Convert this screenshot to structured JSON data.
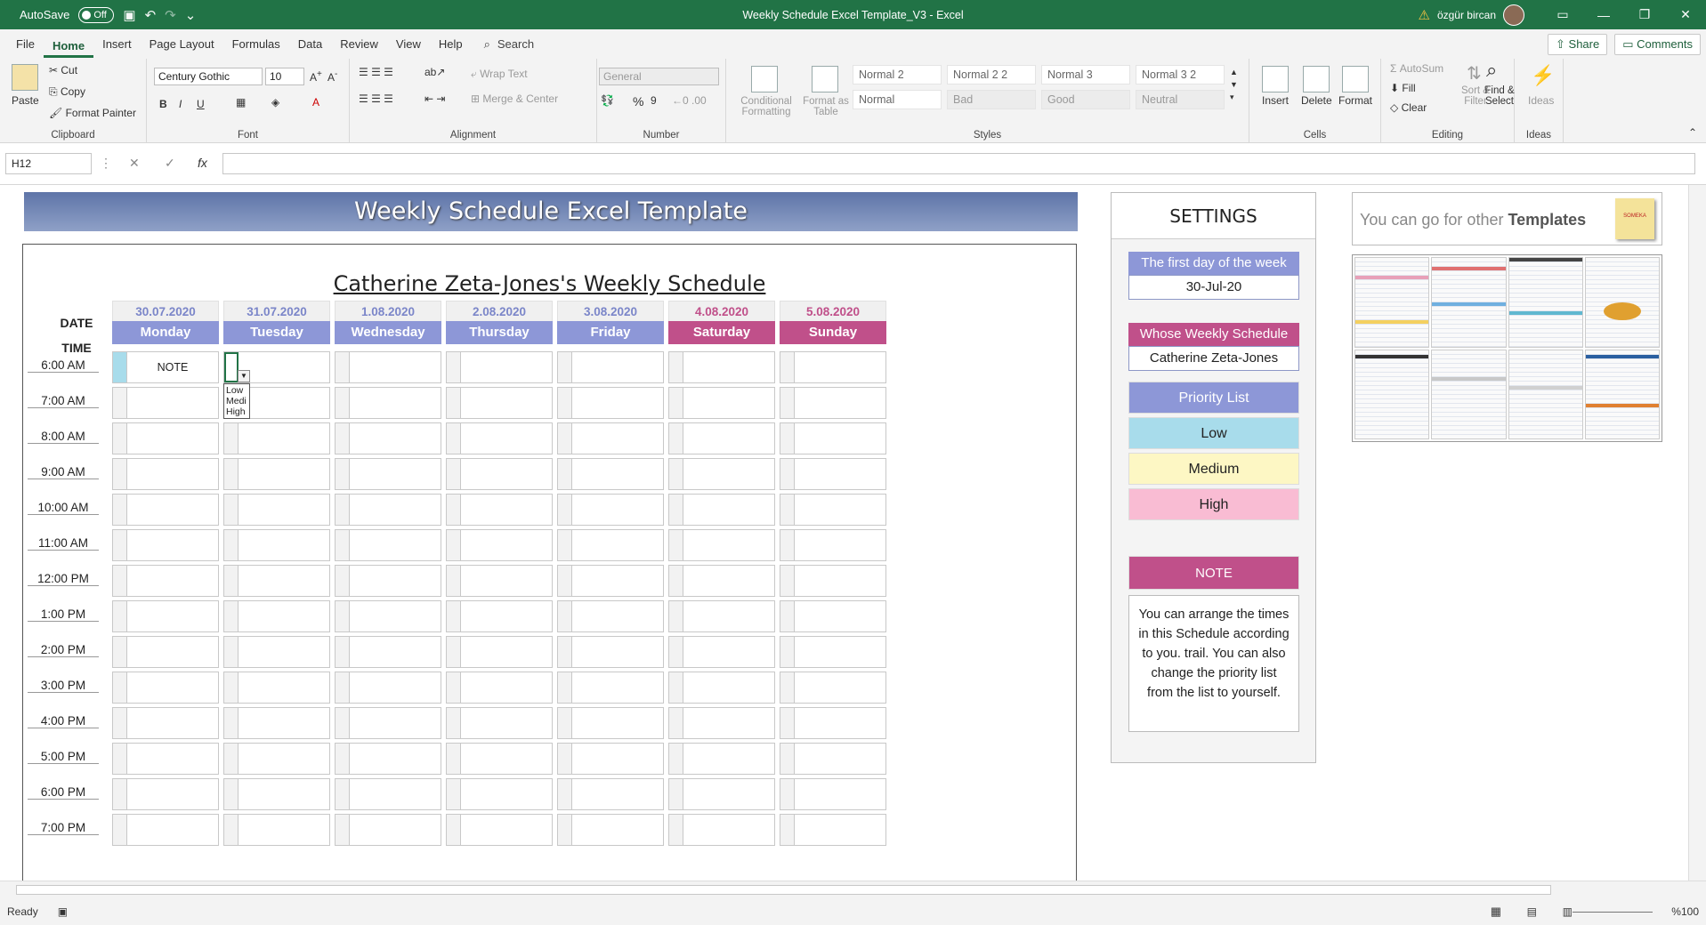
{
  "titlebar": {
    "autosave_label": "AutoSave",
    "autosave_state": "Off",
    "title": "Weekly Schedule Excel Template_V3  -  Excel",
    "user": "özgür bircan",
    "buttons": {
      "ribbon_display": "▭",
      "minimize": "—",
      "restore": "❐",
      "close": "✕"
    }
  },
  "tabs": [
    "File",
    "Home",
    "Insert",
    "Page Layout",
    "Formulas",
    "Data",
    "Review",
    "View",
    "Help"
  ],
  "search_label": "Search",
  "share_label": "Share",
  "comments_label": "Comments",
  "ribbon": {
    "clipboard": {
      "paste": "Paste",
      "cut": "Cut",
      "copy": "Copy",
      "format_painter": "Format Painter",
      "label": "Clipboard"
    },
    "font": {
      "name": "Century Gothic",
      "size": "10",
      "bold": "B",
      "italic": "I",
      "underline": "U",
      "label": "Font"
    },
    "alignment": {
      "wrap": "Wrap Text",
      "merge": "Merge & Center",
      "label": "Alignment"
    },
    "number": {
      "format": "General",
      "label": "Number"
    },
    "styles": {
      "conditional": "Conditional Formatting",
      "format_table": "Format as Table",
      "items": [
        "Normal 2",
        "Normal 2 2",
        "Normal 3",
        "Normal 3 2",
        "Normal",
        "Bad",
        "Good",
        "Neutral"
      ],
      "label": "Styles"
    },
    "cells": {
      "insert": "Insert",
      "delete": "Delete",
      "format": "Format",
      "label": "Cells"
    },
    "editing": {
      "autosum": "AutoSum",
      "fill": "Fill",
      "clear": "Clear",
      "sort": "Sort & Filter",
      "find": "Find & Select",
      "label": "Editing"
    },
    "ideas": {
      "button": "Ideas",
      "label": "Ideas"
    }
  },
  "formula_bar": {
    "name_box": "H12",
    "fx": "fx",
    "value": ""
  },
  "sheet": {
    "banner": "Weekly Schedule Excel Template",
    "schedule_title": "Catherine Zeta-Jones's Weekly Schedule",
    "date_label": "DATE",
    "time_label": "TIME",
    "days": [
      {
        "date": "30.07.2020",
        "name": "Monday",
        "weekend": false
      },
      {
        "date": "31.07.2020",
        "name": "Tuesday",
        "weekend": false
      },
      {
        "date": "1.08.2020",
        "name": "Wednesday",
        "weekend": false
      },
      {
        "date": "2.08.2020",
        "name": "Thursday",
        "weekend": false
      },
      {
        "date": "3.08.2020",
        "name": "Friday",
        "weekend": false
      },
      {
        "date": "4.08.2020",
        "name": "Saturday",
        "weekend": true
      },
      {
        "date": "5.08.2020",
        "name": "Sunday",
        "weekend": true
      }
    ],
    "times": [
      "6:00 AM",
      "7:00 AM",
      "8:00 AM",
      "9:00 AM",
      "10:00 AM",
      "11:00 AM",
      "12:00 PM",
      "1:00 PM",
      "2:00 PM",
      "3:00 PM",
      "4:00 PM",
      "5:00 PM",
      "6:00 PM",
      "7:00 PM"
    ],
    "first_note": "NOTE",
    "dropdown_options": [
      "Low",
      "Medi",
      "High"
    ],
    "settings": {
      "title": "SETTINGS",
      "first_day_label": "The first day of the week",
      "first_day_value": "30-Jul-20",
      "whose_label": "Whose Weekly Schedule",
      "whose_value": "Catherine Zeta-Jones",
      "priority_label": "Priority List",
      "low": "Low",
      "medium": "Medium",
      "high": "High",
      "note_label": "NOTE",
      "note_text": "You can arrange the times in this Schedule according to you. trail. You can also change the priority list from the list to yourself."
    },
    "templates_text": "You can go for other",
    "templates_bold": "Templates",
    "sticky": "SOMEKA"
  },
  "status": {
    "ready": "Ready",
    "zoom": "%100"
  },
  "colors": {
    "accent": "#217346",
    "weekday": "#8d97d7",
    "weekend": "#c0508a",
    "weekday_date": "#7b86c9",
    "weekend_date": "#c0508a",
    "low": "#a8dceb",
    "medium": "#fdf7c4",
    "high": "#f9bcd3",
    "whose": "#c0508a",
    "note": "#c0508a"
  }
}
